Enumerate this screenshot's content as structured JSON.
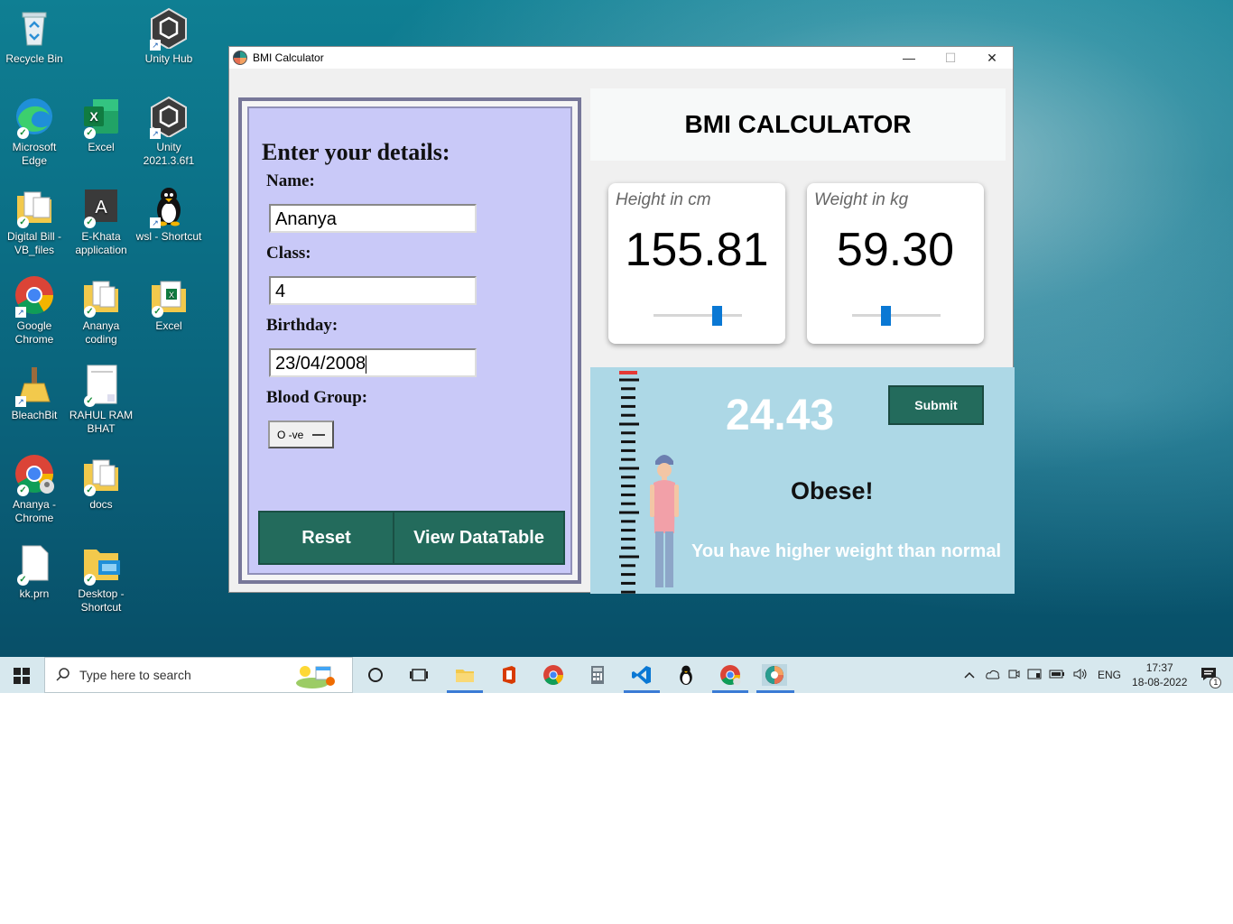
{
  "desktop": {
    "icons": [
      {
        "label": "Recycle Bin",
        "icon": "recycle-bin-icon"
      },
      {
        "label": "Unity Hub",
        "icon": "unity-icon"
      },
      {
        "label": "Microsoft Edge",
        "icon": "edge-icon"
      },
      {
        "label": "Excel",
        "icon": "excel-icon"
      },
      {
        "label": "Unity 2021.3.6f1",
        "icon": "unity-icon"
      },
      {
        "label": "Digital Bill - VB_files",
        "icon": "folder-icon"
      },
      {
        "label": "E-Khata application",
        "icon": "app-icon"
      },
      {
        "label": "wsl - Shortcut",
        "icon": "linux-penguin-icon"
      },
      {
        "label": "Google Chrome",
        "icon": "chrome-icon"
      },
      {
        "label": "Ananya coding",
        "icon": "folder-icon"
      },
      {
        "label": "Excel",
        "icon": "excel-file-icon"
      },
      {
        "label": "BleachBit",
        "icon": "broom-icon"
      },
      {
        "label": "RAHUL RAM BHAT",
        "icon": "document-icon"
      },
      {
        "label": "Ananya - Chrome",
        "icon": "chrome-profile-icon"
      },
      {
        "label": "docs",
        "icon": "folder-icon"
      },
      {
        "label": "kk.prn",
        "icon": "file-icon"
      },
      {
        "label": "Desktop - Shortcut",
        "icon": "folder-shortcut-icon"
      }
    ]
  },
  "window": {
    "title": "BMI Calculator",
    "controls": {
      "minimize": "—",
      "maximize": "☐",
      "close": "✕"
    }
  },
  "form": {
    "heading": "Enter your details:",
    "name_label": "Name:",
    "name_value": "Ananya",
    "class_label": "Class:",
    "class_value": "4",
    "birthday_label": "Birthday:",
    "birthday_value": "23/04/2008",
    "blood_label": "Blood Group:",
    "blood_value": "O -ve",
    "reset_label": "Reset",
    "view_label": "View DataTable"
  },
  "calculator": {
    "title": "BMI CALCULATOR",
    "height": {
      "label": "Height in cm",
      "value": "155.81",
      "slider_fraction": 0.72
    },
    "weight": {
      "label": "Weight in kg",
      "value": "59.30",
      "slider_fraction": 0.38
    },
    "bmi_value": "24.43",
    "submit_label": "Submit",
    "status": "Obese!",
    "message": "You have higher weight than normal"
  },
  "taskbar": {
    "search_placeholder": "Type here to search",
    "language": "ENG",
    "time": "17:37",
    "date": "18-08-2022",
    "notification_count": "1"
  },
  "colors": {
    "accent_teal": "#236b5c",
    "form_bg": "#c9c9f8",
    "result_bg": "#add8e6",
    "slider_blue": "#0a78d4"
  }
}
